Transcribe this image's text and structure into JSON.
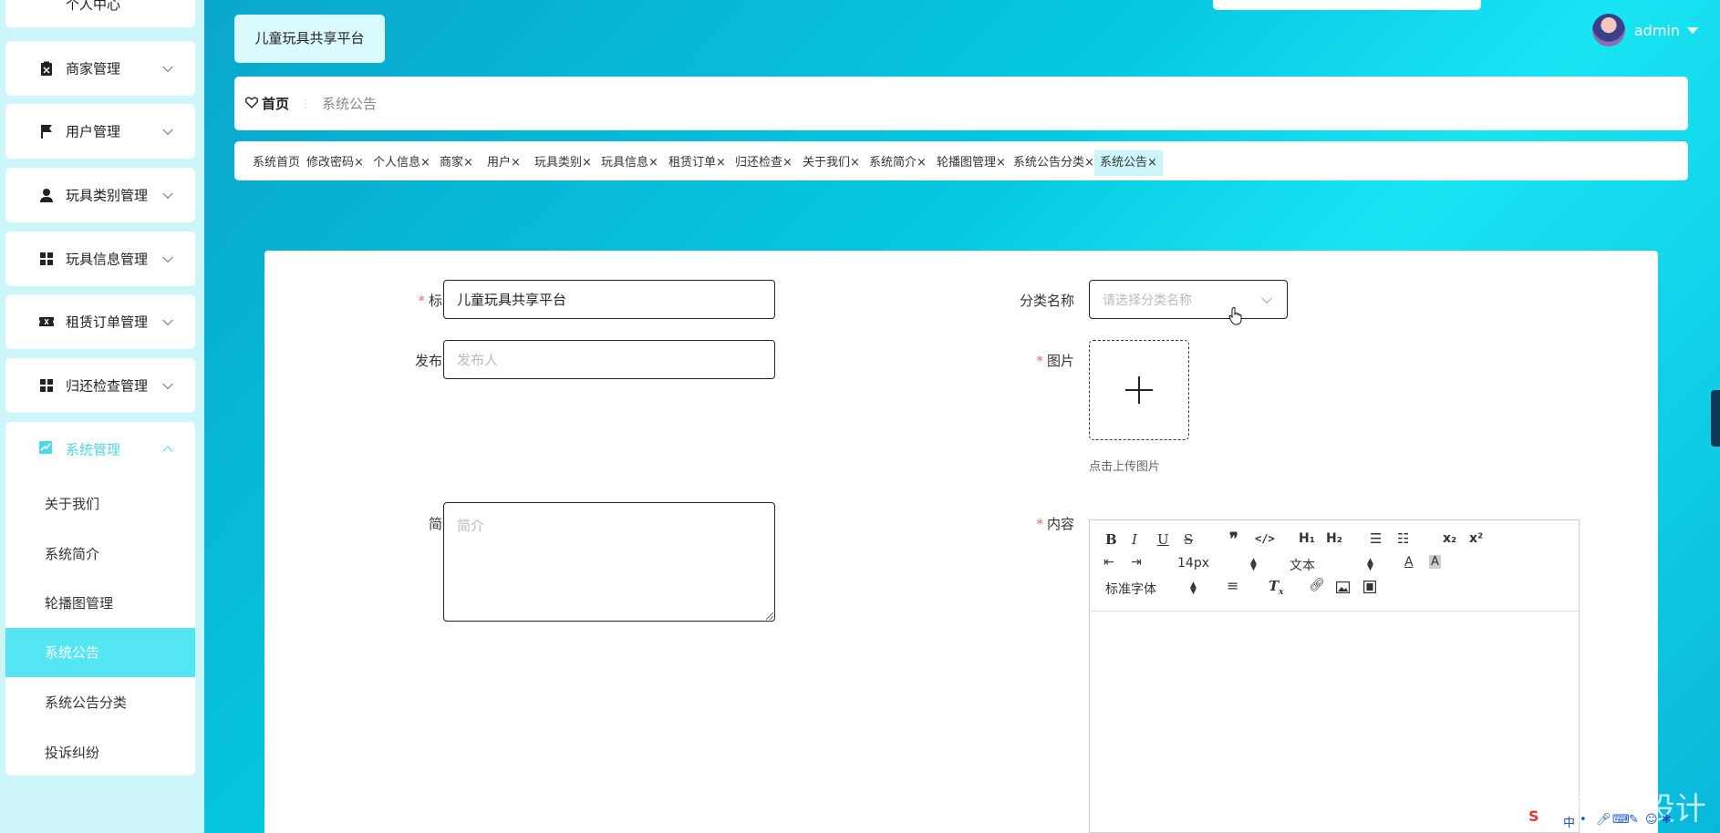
{
  "sidebar": {
    "top_clipped_label": "个人中心",
    "items": [
      {
        "label": "商家管理",
        "icon": "clipboard-icon"
      },
      {
        "label": "用户管理",
        "icon": "flag-icon"
      },
      {
        "label": "玩具类别管理",
        "icon": "user-icon"
      },
      {
        "label": "玩具信息管理",
        "icon": "grid-icon"
      },
      {
        "label": "租赁订单管理",
        "icon": "ticket-icon"
      },
      {
        "label": "归还检查管理",
        "icon": "grid-icon"
      }
    ],
    "system": {
      "label": "系统管理",
      "icon": "chart-icon",
      "children": [
        "关于我们",
        "系统简介",
        "轮播图管理",
        "系统公告",
        "系统公告分类",
        "投诉纠纷"
      ],
      "active_child": "系统公告"
    }
  },
  "header": {
    "brand": "儿童玩具共享平台",
    "user_name": "admin"
  },
  "breadcrumb": {
    "home": "首页",
    "current": "系统公告"
  },
  "tabs": [
    {
      "label": "系统首页",
      "closable": false
    },
    {
      "label": "修改密码",
      "closable": true
    },
    {
      "label": "个人信息",
      "closable": true
    },
    {
      "label": "商家",
      "closable": true
    },
    {
      "label": "用户",
      "closable": true
    },
    {
      "label": "玩具类别",
      "closable": true
    },
    {
      "label": "玩具信息",
      "closable": true
    },
    {
      "label": "租赁订单",
      "closable": true
    },
    {
      "label": "归还检查",
      "closable": true
    },
    {
      "label": "关于我们",
      "closable": true
    },
    {
      "label": "系统简介",
      "closable": true
    },
    {
      "label": "轮播图管理",
      "closable": true
    },
    {
      "label": "系统公告分类",
      "closable": true
    },
    {
      "label": "系统公告",
      "closable": true,
      "active": true
    }
  ],
  "form": {
    "title_label": "标题",
    "title_value": "儿童玩具共享平台",
    "publisher_label": "发布人",
    "publisher_placeholder": "发布人",
    "summary_label": "简介",
    "summary_placeholder": "简介",
    "category_label": "分类名称",
    "category_placeholder": "请选择分类名称",
    "image_label": "图片",
    "upload_hint": "点击上传图片",
    "content_label": "内容",
    "required_mark": "*"
  },
  "editor": {
    "font_size": "14px",
    "text_type": "文本",
    "font_family": "标准字体"
  },
  "watermark": "CSDN @便捷程序设计",
  "colors": {
    "accent": "#55e6f4",
    "required": "#f56c6c",
    "sidebar_bg": "#cdf6fb"
  }
}
